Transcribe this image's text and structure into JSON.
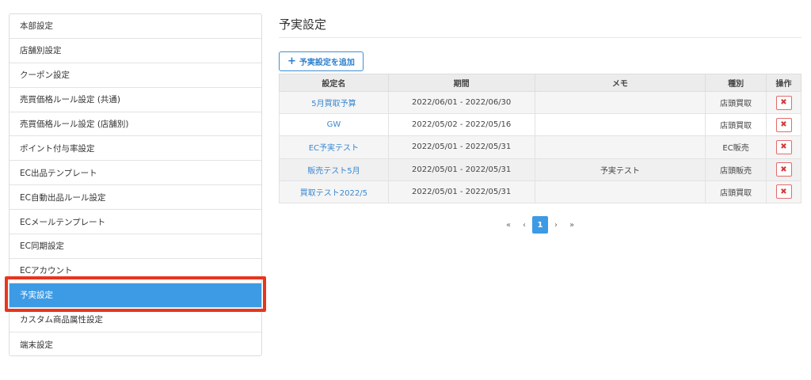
{
  "sidebar": {
    "items": [
      {
        "label": "本部設定"
      },
      {
        "label": "店舗別設定"
      },
      {
        "label": "クーポン設定"
      },
      {
        "label": "売買価格ルール設定 (共通)"
      },
      {
        "label": "売買価格ルール設定 (店舗別)"
      },
      {
        "label": "ポイント付与率設定"
      },
      {
        "label": "EC出品テンプレート"
      },
      {
        "label": "EC自動出品ルール設定"
      },
      {
        "label": "ECメールテンプレート"
      },
      {
        "label": "EC同期設定"
      },
      {
        "label": "ECアカウント"
      },
      {
        "label": "予実設定"
      },
      {
        "label": "カスタム商品属性設定"
      },
      {
        "label": "端末設定"
      }
    ],
    "active_index": 11
  },
  "main": {
    "title": "予実設定",
    "add_button_label": "予実設定を追加",
    "table": {
      "headers": [
        "設定名",
        "期間",
        "メモ",
        "種別",
        "操作"
      ],
      "rows": [
        {
          "name": "5月買取予算",
          "period": "2022/06/01 - 2022/06/30",
          "memo": "",
          "type": "店頭買取"
        },
        {
          "name": "GW",
          "period": "2022/05/02 - 2022/05/16",
          "memo": "",
          "type": "店頭買取"
        },
        {
          "name": "EC予実テスト",
          "period": "2022/05/01 - 2022/05/31",
          "memo": "",
          "type": "EC販売"
        },
        {
          "name": "販売テスト5月",
          "period": "2022/05/01 - 2022/05/31",
          "memo": "予実テスト",
          "type": "店頭販売"
        },
        {
          "name": "買取テスト2022/5",
          "period": "2022/05/01 - 2022/05/31",
          "memo": "",
          "type": "店頭買取"
        }
      ],
      "delete_glyph": "✖"
    },
    "pagination": {
      "first": "«",
      "prev": "‹",
      "current": "1",
      "next": "›",
      "last": "»"
    }
  },
  "colors": {
    "accent": "#3d9be5",
    "highlight": "#e8351f",
    "link": "#3a88d0",
    "danger": "#d43b3b"
  }
}
